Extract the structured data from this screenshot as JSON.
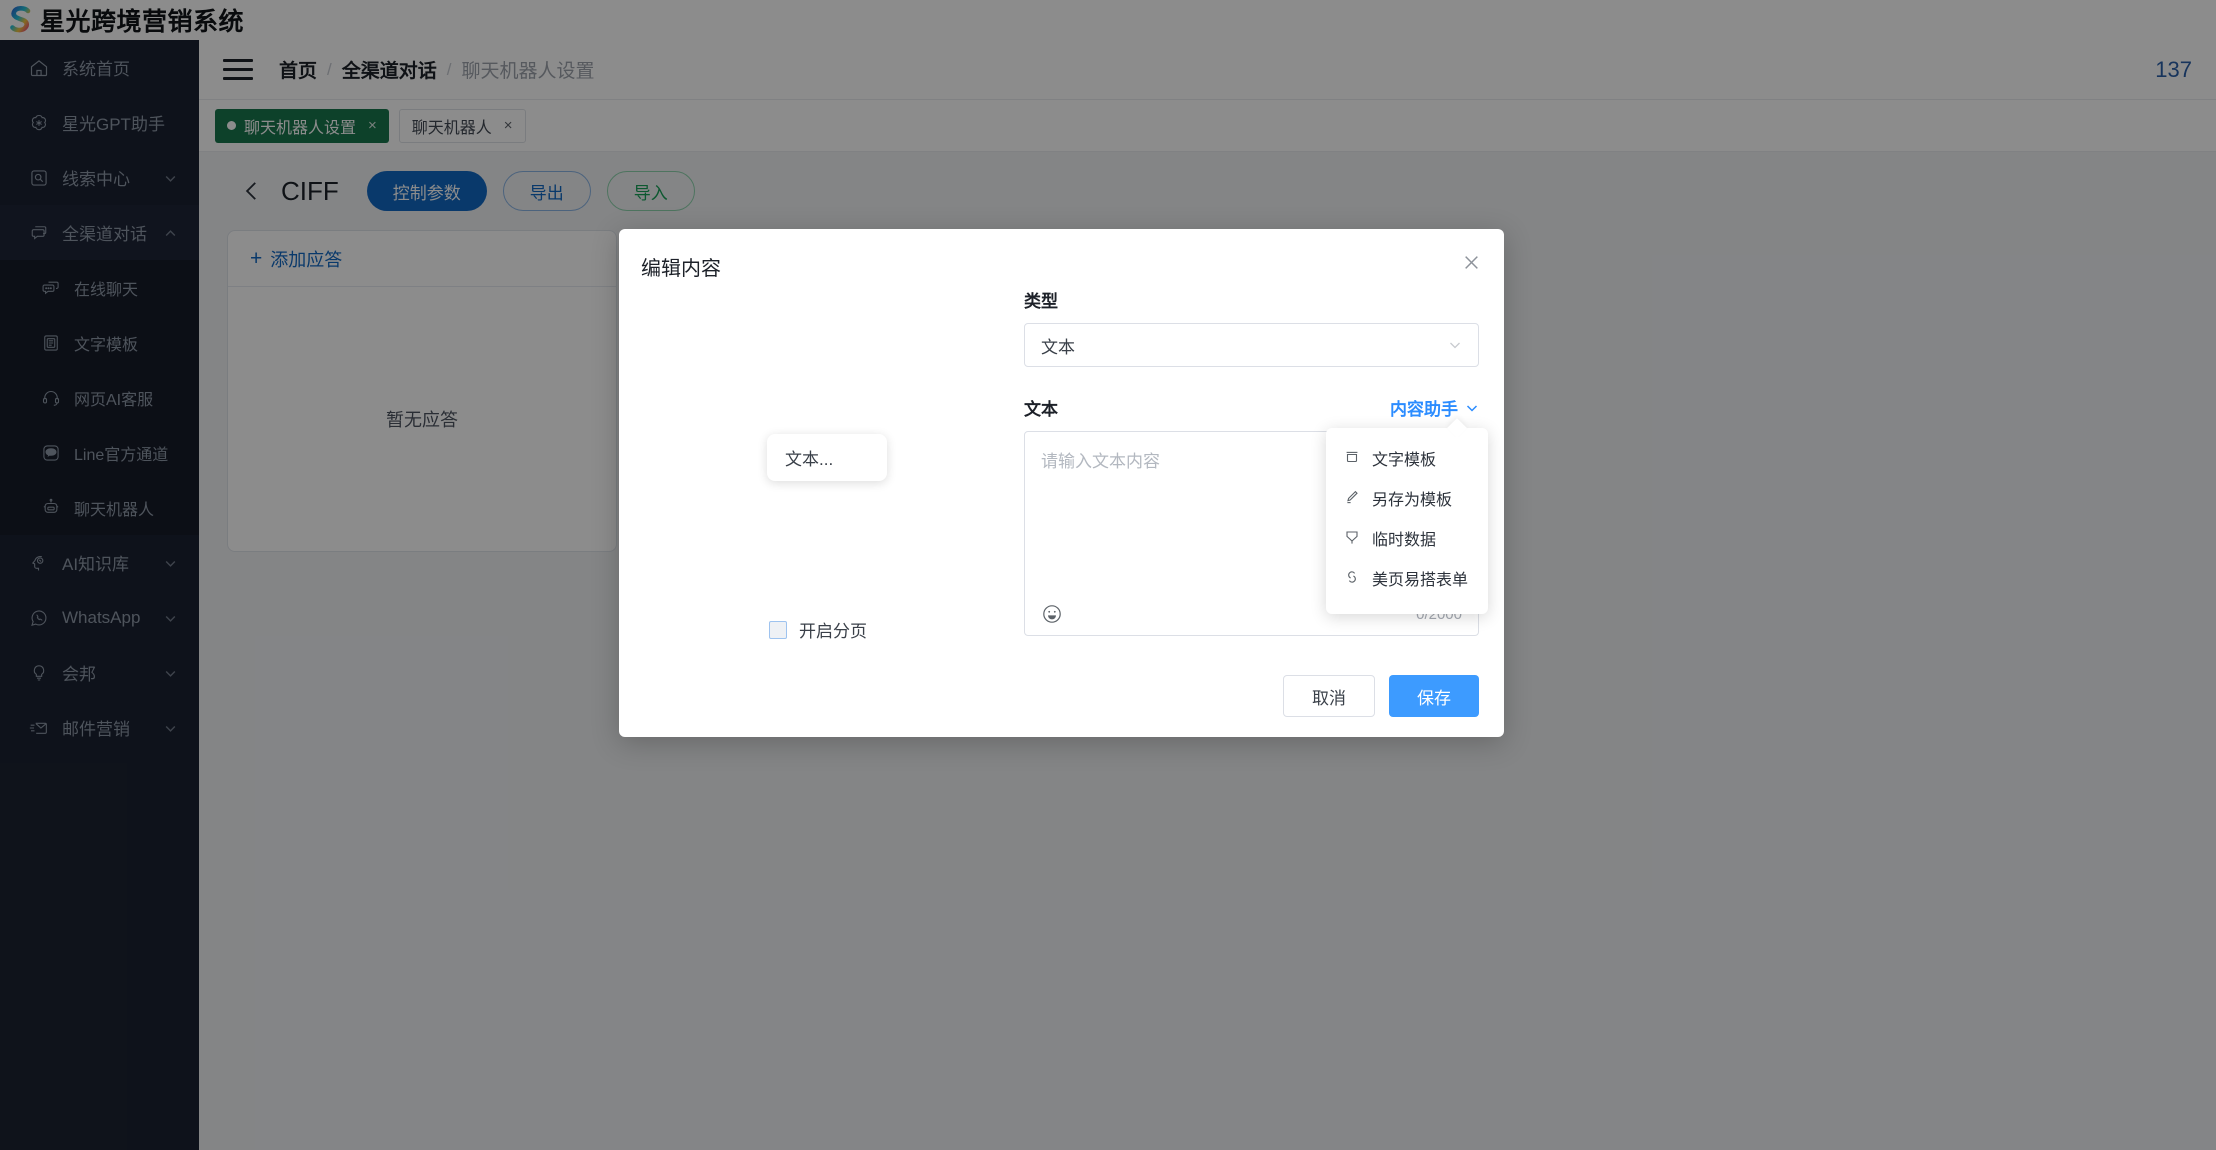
{
  "brand": {
    "name": "星光跨境营销系统",
    "logo_icon": "s-logo-icon"
  },
  "sidebar": {
    "items": [
      {
        "label": "系统首页",
        "icon": "home-icon",
        "caret": false
      },
      {
        "label": "星光GPT助手",
        "icon": "gpt-icon",
        "caret": false
      },
      {
        "label": "线索中心",
        "icon": "lead-search-icon",
        "caret": true
      },
      {
        "label": "全渠道对话",
        "icon": "chat-bubbles-icon",
        "caret": true,
        "open": true
      }
    ],
    "sub_items": [
      {
        "label": "在线聊天",
        "icon": "online-chat-icon"
      },
      {
        "label": "文字模板",
        "icon": "text-template-icon"
      },
      {
        "label": "网页AI客服",
        "icon": "headset-icon"
      },
      {
        "label": "Line官方通道",
        "icon": "line-icon"
      },
      {
        "label": "聊天机器人",
        "icon": "robot-icon"
      }
    ],
    "items_after": [
      {
        "label": "AI知识库",
        "icon": "ai-brain-icon",
        "caret": true
      },
      {
        "label": "WhatsApp",
        "icon": "whatsapp-icon",
        "caret": true
      },
      {
        "label": "会邦",
        "icon": "bulb-icon",
        "caret": true
      },
      {
        "label": "邮件营销",
        "icon": "email-marketing-icon",
        "caret": true
      }
    ]
  },
  "topbar": {
    "menu_icon": "hamburger-icon",
    "breadcrumb": [
      "首页",
      "全渠道对话",
      "聊天机器人设置"
    ],
    "separator": "/",
    "right_counter": "137"
  },
  "tabs": [
    {
      "label": "聊天机器人设置",
      "active": true,
      "close": "×",
      "dot": true
    },
    {
      "label": "聊天机器人",
      "active": false,
      "close": "×",
      "dot": false
    }
  ],
  "page": {
    "back_icon": "chevron-left-icon",
    "title": "CIFF",
    "buttons": [
      {
        "label": "控制参数",
        "style": "primary"
      },
      {
        "label": "导出",
        "style": "ghost-blue"
      },
      {
        "label": "导入",
        "style": "ghost-green"
      }
    ],
    "left_card": {
      "add_label": "添加应答",
      "plus": "+",
      "empty_text": "暂无应答"
    }
  },
  "modal": {
    "title": "编辑内容",
    "close_icon": "close-icon",
    "preview": {
      "bubble_text": "文本...",
      "pagination_label": "开启分页",
      "pagination_checked": false
    },
    "type_field": {
      "label": "类型",
      "value": "文本",
      "caret_icon": "chevron-down-icon"
    },
    "text_field": {
      "label": "文本",
      "helper_label": "内容助手",
      "helper_caret_icon": "chevron-down-icon",
      "placeholder": "请输入文本内容",
      "value": "",
      "emoji_icon": "emoji-smile-icon",
      "char_count": "0/2000"
    },
    "helper_menu": [
      {
        "label": "文字模板",
        "icon": "template-icon"
      },
      {
        "label": "另存为模板",
        "icon": "pencil-icon"
      },
      {
        "label": "临时数据",
        "icon": "data-icon"
      },
      {
        "label": "美页易搭表单",
        "icon": "form-icon"
      }
    ],
    "footer": {
      "cancel_label": "取消",
      "save_label": "保存"
    }
  },
  "colors": {
    "sidebar_bg": "#1b2232",
    "tab_active": "#19774e",
    "primary_blue": "#1268c3",
    "save_blue": "#3d9bff",
    "helper_blue": "#2b8cff",
    "green": "#18a058"
  }
}
